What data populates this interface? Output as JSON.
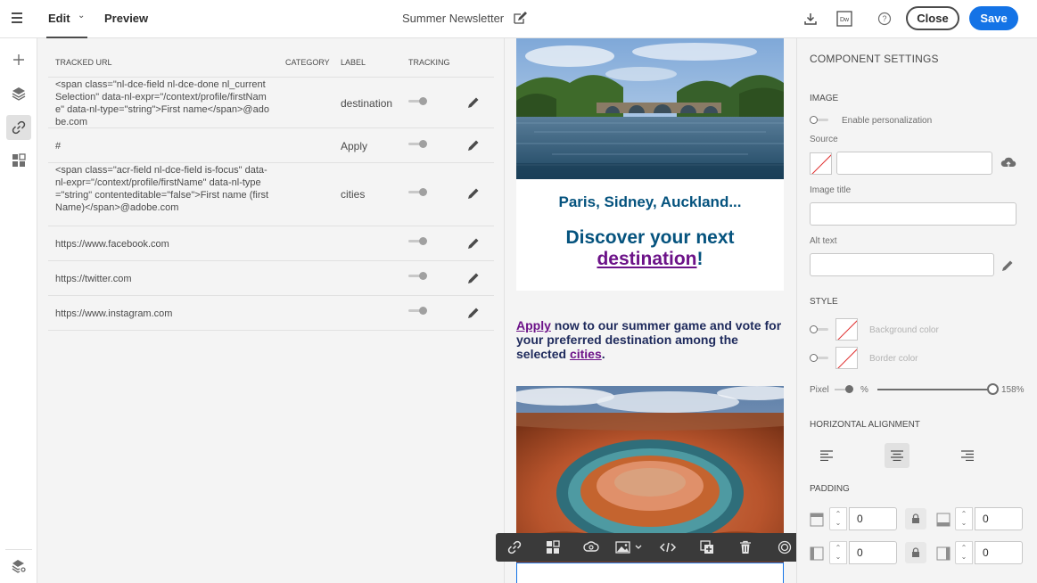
{
  "header": {
    "tab_edit": "Edit",
    "tab_preview": "Preview",
    "title": "Summer Newsletter",
    "close_label": "Close",
    "save_label": "Save",
    "help_glyph": "?",
    "dw_glyph": "Dw"
  },
  "links": {
    "columns": {
      "url": "TRACKED URL",
      "category": "CATEGORY",
      "label": "LABEL",
      "tracking": "TRACKING"
    },
    "rows": [
      {
        "url": "<span class=\"nl-dce-field nl-dce-done nl_currentSelection\" data-nl-expr=\"/context/profile/firstName\" data-nl-type=\"string\">First name</span>@adobe.com",
        "label": "destination"
      },
      {
        "url": "#",
        "label": "Apply"
      },
      {
        "url": "<span class=\"acr-field nl-dce-field is-focus\" data-nl-expr=\"/context/profile/firstName\" data-nl-type=\"string\" contenteditable=\"false\">First name (firstName)</span>@adobe.com",
        "label": "cities"
      },
      {
        "url": "https://www.facebook.com",
        "label": ""
      },
      {
        "url": "https://twitter.com",
        "label": ""
      },
      {
        "url": "https://www.instagram.com",
        "label": ""
      }
    ]
  },
  "email": {
    "headline_small": "Paris, Sidney, Auckland...",
    "headline_large_pre": "Discover your next",
    "headline_large_link": "destination",
    "headline_large_post": "!",
    "para_link1": "Apply",
    "para_mid": " now to our summer game and vote for your preferred destination among the selected ",
    "para_link2": "cities",
    "para_end": "."
  },
  "settings": {
    "title": "COMPONENT SETTINGS",
    "image_section": "IMAGE",
    "enable_personalization": "Enable personalization",
    "source_label": "Source",
    "source_value": "",
    "image_title_label": "Image title",
    "image_title_value": "",
    "alt_text_label": "Alt text",
    "alt_text_value": "",
    "style_section": "STYLE",
    "background_color": "Background color",
    "border_color": "Border color",
    "pixel_label": "Pixel",
    "percent_label": "%",
    "width_percent": "158%",
    "width_slider_fraction": 0.99,
    "halign_section": "HORIZONTAL ALIGNMENT",
    "halign_selected": "center",
    "padding_section": "PADDING",
    "padding_top": "0",
    "padding_bottom": "0",
    "padding_left": "0",
    "padding_right": "0"
  },
  "colors": {
    "accent": "#1473e6",
    "headline": "#05537e",
    "link": "#6c1288"
  }
}
